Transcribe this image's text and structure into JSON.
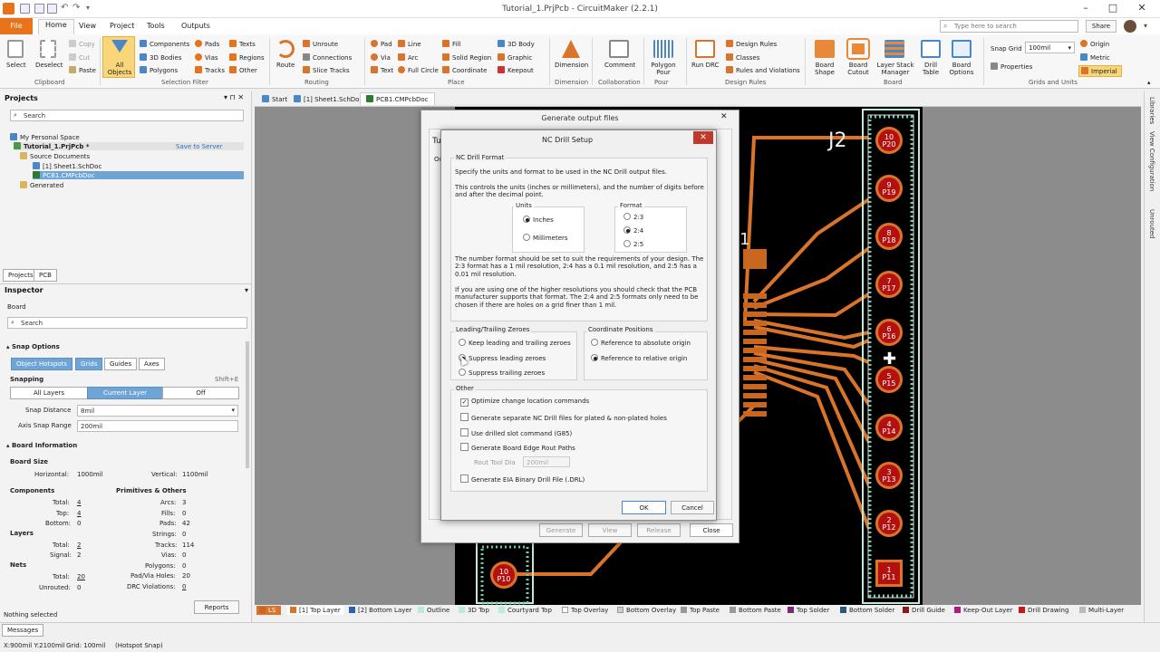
{
  "app": {
    "title": "Tutorial_1.PrjPcb - CircuitMaker (2.2.1)"
  },
  "menu": {
    "file": "File",
    "home": "Home",
    "view": "View",
    "project": "Project",
    "tools": "Tools",
    "outputs": "Outputs"
  },
  "topbar": {
    "search_placeholder": "Type here to search",
    "share": "Share"
  },
  "ribbon": {
    "clipboard": {
      "select": "Select",
      "deselect": "Deselect",
      "copy": "Copy",
      "cut": "Cut",
      "paste": "Paste",
      "group": "Clipboard"
    },
    "filter": {
      "all_objects": "All\nObjects",
      "components": "Components",
      "bodies3d": "3D Bodies",
      "polygons": "Polygons",
      "pads": "Pads",
      "vias": "Vias",
      "tracks": "Tracks",
      "texts": "Texts",
      "regions": "Regions",
      "other": "Other",
      "group": "Selection Filter"
    },
    "routing": {
      "route": "Route",
      "unroute": "Unroute",
      "connections": "Connections",
      "slice_tracks": "Slice Tracks",
      "group": "Routing"
    },
    "place": {
      "pad": "Pad",
      "via": "Via",
      "text": "Text",
      "line": "Line",
      "arc": "Arc",
      "full_circle": "Full Circle",
      "fill": "Fill",
      "solid_region": "Solid Region",
      "coordinate": "Coordinate",
      "body3d": "3D Body",
      "graphic": "Graphic",
      "keepout": "Keepout",
      "group": "Place"
    },
    "dimension": {
      "label": "Dimension",
      "group": "Dimension"
    },
    "collab": {
      "label": "Comment",
      "group": "Collaboration"
    },
    "pour": {
      "label": "Polygon Pour",
      "group": "Pour"
    },
    "drc": {
      "label": "Run DRC",
      "design_rules": "Design Rules",
      "classes": "Classes",
      "rules_violations": "Rules and Violations",
      "group": "Design Rules"
    },
    "board": {
      "shape": "Board Shape",
      "cutout": "Board Cutout",
      "layer_stack": "Layer Stack Manager",
      "drill_table": "Drill Table",
      "options": "Board Options",
      "group": "Board"
    },
    "grids": {
      "snap_grid_label": "Snap Grid",
      "snap_grid_value": "100mil",
      "properties": "Properties",
      "origin": "Origin",
      "metric": "Metric",
      "imperial": "Imperial",
      "group": "Grids and Units"
    }
  },
  "projects": {
    "title": "Projects",
    "search": "Search",
    "personal": "My Personal Space",
    "project": "Tutorial_1.PrjPcb *",
    "save": "Save to Server",
    "source_docs": "Source Documents",
    "sheet": "[1] Sheet1.SchDoc",
    "pcb": "PCB1.CMPcbDoc",
    "generated": "Generated",
    "tab_projects": "Projects",
    "tab_pcb": "PCB"
  },
  "inspector": {
    "title": "Inspector",
    "board": "Board",
    "search": "Search",
    "snap_options": "Snap Options",
    "object_hotspots": "Object Hotspots",
    "grids": "Grids",
    "guides": "Guides",
    "axes": "Axes",
    "snapping": "Snapping",
    "shortcut": "Shift+E",
    "all_layers": "All Layers",
    "current_layer": "Current Layer",
    "off": "Off",
    "snap_distance_label": "Snap Distance",
    "snap_distance": "8mil",
    "axis_snap_label": "Axis Snap Range",
    "axis_snap": "200mil",
    "board_info": "Board Information",
    "board_size": "Board Size",
    "horizontal_label": "Horizontal:",
    "horizontal": "1000mil",
    "vertical_label": "Vertical:",
    "vertical": "1100mil",
    "components": "Components",
    "total_label": "Total:",
    "comp_total": "4",
    "top_label": "Top:",
    "comp_top": "4",
    "bottom_label": "Bottom:",
    "comp_bottom": "0",
    "primitives": "Primitives & Others",
    "arcs_label": "Arcs:",
    "arcs": "3",
    "fills_label": "Fills:",
    "fills": "0",
    "pads_label": "Pads:",
    "pads": "42",
    "strings_label": "Strings:",
    "strings": "0",
    "tracks_label": "Tracks:",
    "tracks": "114",
    "vias_label": "Vias:",
    "vias": "0",
    "polygons_label": "Polygons:",
    "polygons": "0",
    "padvia_label": "Pad/Via Holes:",
    "padvia": "20",
    "drc_label": "DRC Violations:",
    "drc": "0",
    "layers": "Layers",
    "layers_total": "2",
    "signal_label": "Signal:",
    "layers_signal": "2",
    "nets": "Nets",
    "nets_total": "20",
    "unrouted_label": "Unrouted:",
    "unrouted": "0",
    "reports": "Reports",
    "nothing_selected": "Nothing selected"
  },
  "doctabs": {
    "start": "Start",
    "sheet": "[1] Sheet1.SchDoc",
    "pcb": "PCB1.CMPcbDoc"
  },
  "rightbar": {
    "libraries": "Libraries",
    "view_config": "View Configuration",
    "unrouted": "Unrouted"
  },
  "layers": {
    "ls": "LS",
    "top": "[1] Top Layer",
    "bottom": "[2] Bottom Layer",
    "outline": "Outline",
    "top3d": "3D Top",
    "courtyard": "Courtyard Top",
    "top_overlay": "Top Overlay",
    "bottom_overlay": "Bottom Overlay",
    "top_paste": "Top Paste",
    "bottom_paste": "Bottom Paste",
    "top_solder": "Top Solder",
    "bottom_solder": "Bottom Solder",
    "drill_guide": "Drill Guide",
    "keepout": "Keep-Out Layer",
    "drill_drawing": "Drill Drawing",
    "multi": "Multi-Layer"
  },
  "status": {
    "messages": "Messages",
    "coords": "X:900mil Y:2100mil",
    "grid": "Grid: 100mil",
    "snap": "(Hotspot Snap)"
  },
  "pcb": {
    "j2": "J2",
    "one": "1",
    "pads": [
      {
        "n": "10",
        "p": "P20"
      },
      {
        "n": "9",
        "p": "P19"
      },
      {
        "n": "8",
        "p": "P18"
      },
      {
        "n": "7",
        "p": "P17"
      },
      {
        "n": "6",
        "p": "P16"
      },
      {
        "n": "5",
        "p": "P15"
      },
      {
        "n": "4",
        "p": "P14"
      },
      {
        "n": "3",
        "p": "P13"
      },
      {
        "n": "2",
        "p": "P12"
      },
      {
        "n": "1",
        "p": "P11"
      }
    ],
    "left_pad": {
      "n": "10",
      "p": "P10"
    }
  },
  "outdlg": {
    "title": "Generate output files",
    "tu": "Tu",
    "ou": "Ou",
    "generate": "Generate",
    "view": "View",
    "release": "Release",
    "close": "Close"
  },
  "nc": {
    "title": "NC Drill Setup",
    "format_group": "NC Drill Format",
    "p1": "Specify the units and format to be used in the NC Drill output files.",
    "p2": "This controls the units (inches or millimeters), and the number of digits before and after the decimal point.",
    "units": "Units",
    "inches": "Inches",
    "mm": "Millimeters",
    "format": "Format",
    "f23": "2:3",
    "f24": "2:4",
    "f25": "2:5",
    "p3": "The number format should be set to suit the requirements of your design. The 2:3 format has a 1 mil resolution, 2:4 has a 0.1 mil resolution, and 2:5 has a 0.01 mil resolution.",
    "p4": "If you are using one of the higher resolutions you should check that the PCB manufacturer supports that format. The 2:4 and 2:5 formats only need to be chosen if there are holes on a grid finer than 1 mil.",
    "zeros": "Leading/Trailing Zeroes",
    "keep": "Keep leading and trailing zeroes",
    "suppress_leading": "Suppress leading zeroes",
    "suppress_trailing": "Suppress trailing zeroes",
    "coords": "Coordinate Positions",
    "absolute": "Reference to absolute origin",
    "relative": "Reference to relative origin",
    "other": "Other",
    "optimize": "Optimize change location commands",
    "separate": "Generate separate NC Drill files for plated & non-plated holes",
    "slot": "Use drilled slot command (G85)",
    "rout": "Generate Board Edge Rout Paths",
    "rout_dia_label": "Rout Tool Dia",
    "rout_dia": "200mil",
    "eia": "Generate EIA Binary Drill File (.DRL)",
    "ok": "OK",
    "cancel": "Cancel"
  }
}
